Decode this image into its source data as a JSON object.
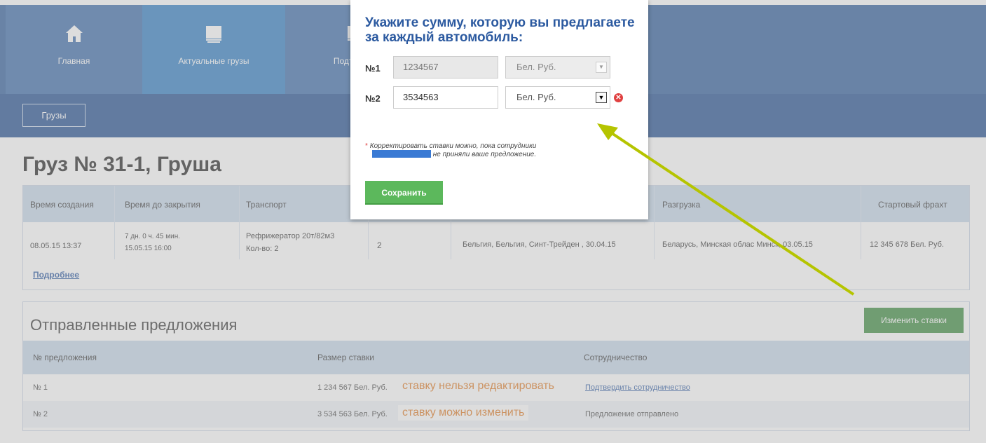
{
  "nav": {
    "tabs": [
      {
        "label": "Главная",
        "icon": "home-icon"
      },
      {
        "label": "Актуальные грузы",
        "icon": "monitor-icon"
      },
      {
        "label": "Подтвержд",
        "icon": "monitor-icon"
      }
    ],
    "sub_button": "Грузы"
  },
  "cargo": {
    "title": "Груз № 31-1, Груша",
    "headers": [
      "Время создания",
      "Время до закрытия",
      "Транспорт",
      "Разгрузка",
      "Стартовый фрахт"
    ],
    "row": {
      "created": "08.05.15 13:37",
      "remaining_1": "7 дн. 0 ч. 45 мин.",
      "remaining_2": "15.05.15 16:00",
      "transport_1": "Рефрижератор 20т/82м3",
      "transport_2": "Кол-во: 2",
      "count": "2",
      "loading": "Бельгия, Бельгия, Синт-Трейден , 30.04.15",
      "unloading": "Беларусь, Минская облас    Минск, 03.05.15",
      "freight": "12 345 678 Бел. Руб."
    },
    "more_link": "Подробнее"
  },
  "offers": {
    "title": "Отправленные предложения",
    "change_button": "Изменить ставки",
    "headers": [
      "№ предложения",
      "Размер ставки",
      "Сотрудничество"
    ],
    "rows": [
      {
        "num": "№ 1",
        "amount": "1 234 567 Бел. Руб.",
        "note": "ставку нельзя редактировать",
        "status": "Подтвердить сотрудничество"
      },
      {
        "num": "№ 2",
        "amount": "3 534 563 Бел. Руб.",
        "note": "ставку можно изменить",
        "status": "Предложение отправлено"
      }
    ]
  },
  "modal": {
    "title": "Укажите сумму, которую вы предлагаете за каждый автомобиль:",
    "rows": [
      {
        "label": "№1",
        "value": "1234567",
        "currency": "Бел. Руб."
      },
      {
        "label": "№2",
        "value": "3534563",
        "currency": "Бел. Руб."
      }
    ],
    "footnote_1": "Корректировать ставки можно, пока сотрудники",
    "footnote_2": "не приняли ваше предложение.",
    "save_button": "Сохранить"
  },
  "colors": {
    "nav_blue": "#2d5c9c",
    "active_tab": "#2e7cc4",
    "title_blue": "#2c5aa0",
    "save_green": "#5cb85c",
    "change_green": "#3a8a3c",
    "note_orange": "#e07820",
    "arrow": "#b5c400"
  }
}
